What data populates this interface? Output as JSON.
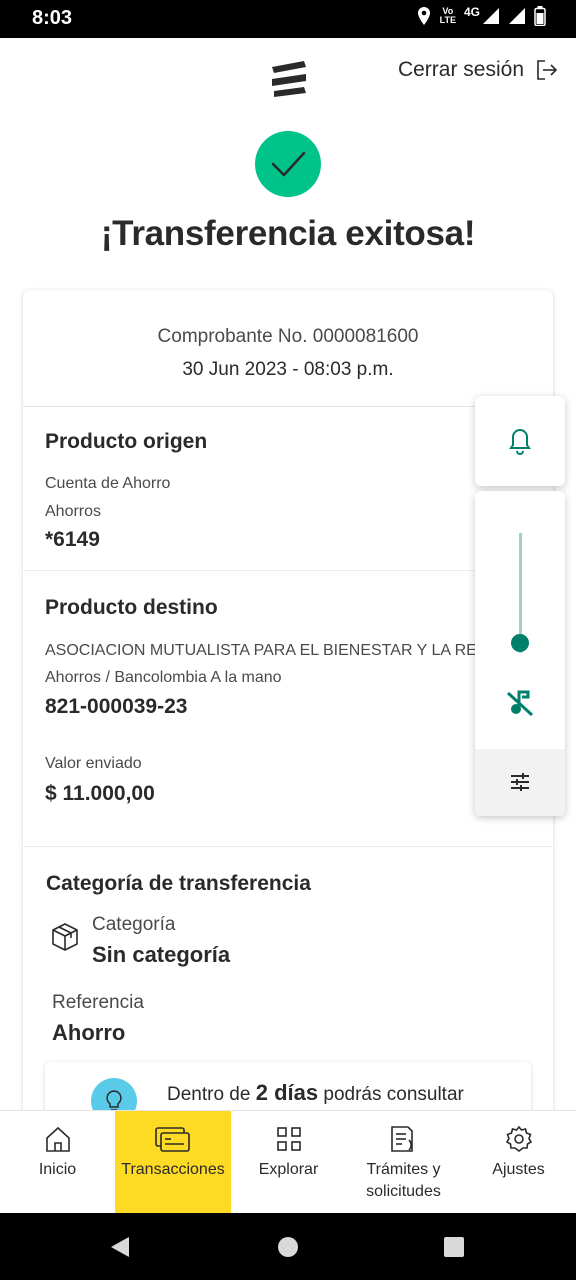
{
  "status_bar": {
    "time": "8:03",
    "volte_top": "Vo",
    "volte_bottom": "LTE",
    "network": "4G"
  },
  "header": {
    "logout_label": "Cerrar sesión"
  },
  "success": {
    "title": "¡Transferencia exitosa!"
  },
  "receipt": {
    "number": "Comprobante No. 0000081600",
    "date": "30 Jun 2023 - 08:03 p.m."
  },
  "origin": {
    "title": "Producto origen",
    "account_type": "Cuenta de Ahorro",
    "account_subtype": "Ahorros",
    "account_number": "*6149"
  },
  "destination": {
    "title": "Producto destino",
    "name": "ASOCIACION MUTUALISTA PARA EL BIENESTAR Y LA RESILI",
    "detail": "Ahorros / Bancolombia A la mano",
    "account_number": "821-000039-23",
    "amount_label": "Valor enviado",
    "amount": "$ 11.000,00"
  },
  "category": {
    "section_title": "Categoría de transferencia",
    "label": "Categoría",
    "value": "Sin categoría",
    "reference_label": "Referencia",
    "reference_value": "Ahorro"
  },
  "tip": {
    "prefix": "Dentro de ",
    "bold": "2 días",
    "suffix": " podrás consultar"
  },
  "floating": {
    "volume_level": 0.08
  },
  "nav": {
    "items": [
      {
        "label": "Inicio"
      },
      {
        "label": "Transacciones"
      },
      {
        "label": "Explorar"
      },
      {
        "label": "Trámites y solicitudes"
      },
      {
        "label": "Ajustes"
      }
    ],
    "active_index": 1
  },
  "colors": {
    "brand_yellow": "#fdda24",
    "success_green": "#00c389",
    "teal": "#00806a",
    "tip_blue": "#59cbe8"
  }
}
